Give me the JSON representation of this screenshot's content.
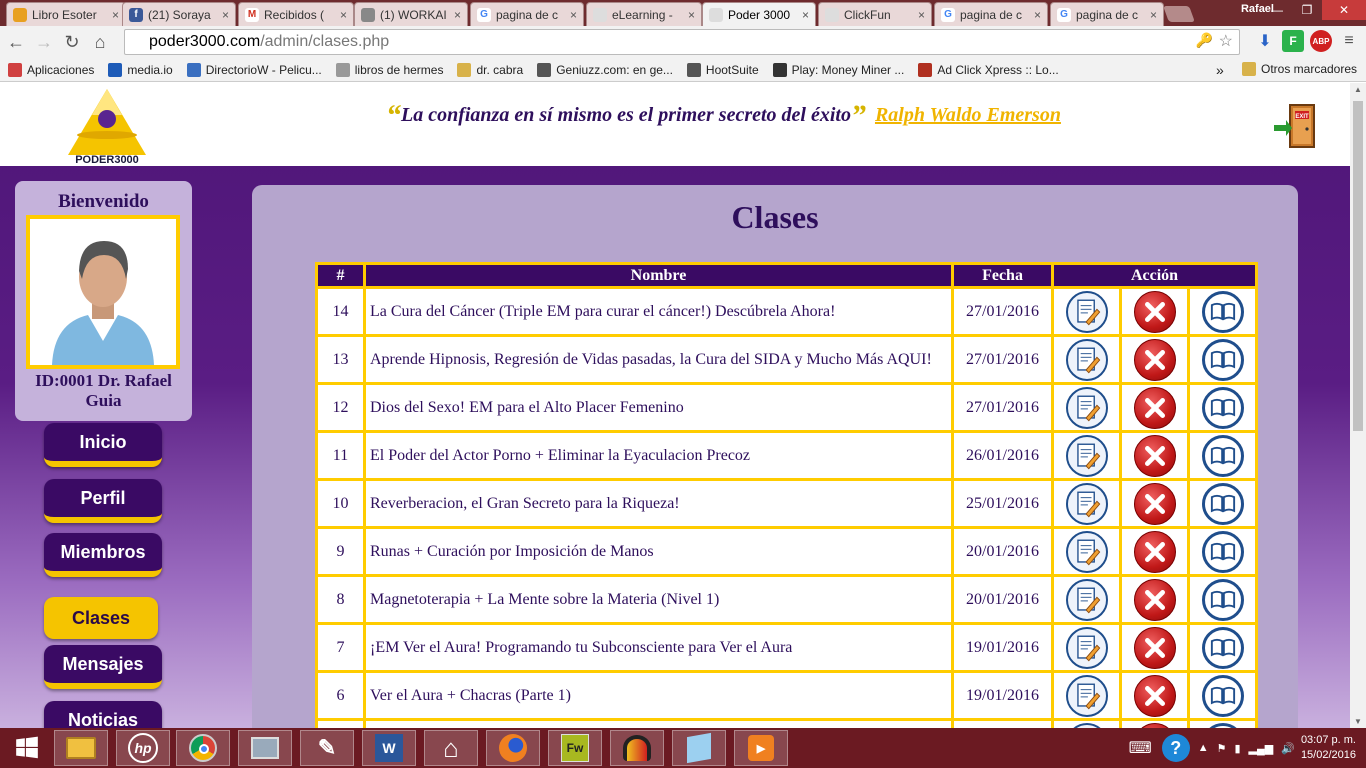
{
  "browser": {
    "tabs": [
      {
        "title": "Libro Esoter",
        "color": "#e8a020",
        "letter": ""
      },
      {
        "title": "(21) Soraya",
        "color": "#3b5998",
        "letter": "f"
      },
      {
        "title": "Recibidos (",
        "color": "#ffffff",
        "letter": "M"
      },
      {
        "title": "(1) WORKAI",
        "color": "#888888",
        "letter": ""
      },
      {
        "title": "pagina de c",
        "color": "#ffffff",
        "letter": "G"
      },
      {
        "title": "eLearning -",
        "color": "#dddddd",
        "letter": ""
      },
      {
        "title": "Poder 3000",
        "color": "#dddddd",
        "letter": ""
      },
      {
        "title": "ClickFun",
        "color": "#dddddd",
        "letter": ""
      },
      {
        "title": "pagina de c",
        "color": "#ffffff",
        "letter": "G"
      },
      {
        "title": "pagina de c",
        "color": "#ffffff",
        "letter": "G"
      }
    ],
    "user": "Rafael",
    "url_host": "poder3000.com",
    "url_path": "/admin/clases.php",
    "bookmarks": [
      {
        "label": "Aplicaciones",
        "color": "#d04040"
      },
      {
        "label": "media.io",
        "color": "#1e5bb8"
      },
      {
        "label": "DirectorioW - Pelicu...",
        "color": "#3a6fc0"
      },
      {
        "label": "libros de hermes",
        "color": "#999999"
      },
      {
        "label": "dr. cabra",
        "color": "#d8b24a"
      },
      {
        "label": "Geniuzz.com: en ge...",
        "color": "#555555"
      },
      {
        "label": "HootSuite",
        "color": "#555555"
      },
      {
        "label": "Play: Money Miner ...",
        "color": "#333333"
      },
      {
        "label": "Ad Click Xpress :: Lo...",
        "color": "#b03020"
      }
    ],
    "other_bookmarks": "Otros marcadores",
    "more_bookmarks": "»"
  },
  "header": {
    "logo_text": "PODER3000",
    "quote_text": "La confianza en sí mismo es el primer secreto del éxito",
    "quote_author": "Ralph Waldo Emerson",
    "exit_label": "EXIT"
  },
  "sidebar": {
    "welcome": "Bienvenido",
    "user_id_line1": "ID:0001 Dr. Rafael",
    "user_id_line2": "Guia",
    "nav": [
      {
        "label": "Inicio",
        "active": false
      },
      {
        "label": "Perfil",
        "active": false
      },
      {
        "label": "Miembros",
        "active": false
      },
      {
        "label": "Clases",
        "active": true
      },
      {
        "label": "Mensajes",
        "active": false
      },
      {
        "label": "Noticias",
        "active": false
      }
    ]
  },
  "main": {
    "title": "Clases",
    "columns": [
      "#",
      "Nombre",
      "Fecha",
      "Acción"
    ],
    "rows": [
      {
        "num": "14",
        "name": "La Cura del Cáncer (Triple EM para curar el cáncer!) Descúbrela Ahora!",
        "date": "27/01/2016"
      },
      {
        "num": "13",
        "name": "Aprende Hipnosis, Regresión de Vidas pasadas, la Cura del SIDA y Mucho Más AQUI!",
        "date": "27/01/2016"
      },
      {
        "num": "12",
        "name": "Dios del Sexo! EM para el Alto Placer Femenino",
        "date": "27/01/2016"
      },
      {
        "num": "11",
        "name": "El Poder del Actor Porno + Eliminar la Eyaculacion Precoz",
        "date": "26/01/2016"
      },
      {
        "num": "10",
        "name": "Reverberacion, el Gran Secreto para la Riqueza!",
        "date": "25/01/2016"
      },
      {
        "num": "9",
        "name": "Runas + Curación por Imposición de Manos",
        "date": "20/01/2016"
      },
      {
        "num": "8",
        "name": "Magnetoterapia + La Mente sobre la Materia (Nivel 1)",
        "date": "20/01/2016"
      },
      {
        "num": "7",
        "name": "¡EM Ver el Aura! Programando tu Subconsciente para Ver el Aura",
        "date": "19/01/2016"
      },
      {
        "num": "6",
        "name": "Ver el Aura + Chacras (Parte 1)",
        "date": "19/01/2016"
      }
    ]
  },
  "taskbar": {
    "time": "03:07 p. m.",
    "date": "15/02/2016",
    "apps": [
      "start",
      "explorer",
      "hp",
      "chrome",
      "monitor",
      "tools",
      "word",
      "home",
      "firefox",
      "fireworks",
      "audio",
      "notes",
      "video"
    ]
  }
}
